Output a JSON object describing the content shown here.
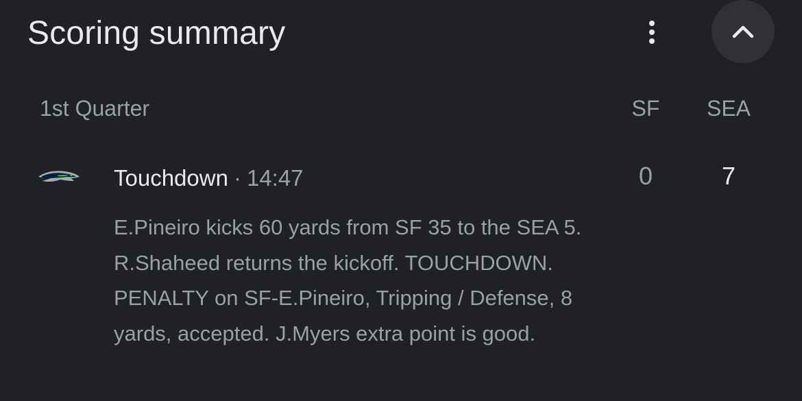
{
  "header": {
    "title": "Scoring summary",
    "more_icon": "more-vert-icon",
    "collapse_icon": "chevron-up-icon"
  },
  "table": {
    "quarter": "1st Quarter",
    "columns": [
      "SF",
      "SEA"
    ]
  },
  "plays": [
    {
      "team_logo": "seahawks-logo",
      "type": "Touchdown",
      "separator": "·",
      "time": "14:47",
      "score_sf": "0",
      "score_sea": "7",
      "description": "E.Pineiro kicks 60 yards from SF 35 to the SEA 5. R.Shaheed returns the kickoff. TOUCHDOWN. PENALTY on SF-E.Pineiro, Tripping / Defense, 8 yards, accepted. J.Myers extra point is good."
    }
  ],
  "colors": {
    "background": "#202124",
    "button_bg": "#303134",
    "primary_text": "#e8eaed",
    "secondary_text": "#9aa0a6",
    "seahawks_navy": "#002244",
    "seahawks_green": "#69be28",
    "seahawks_gray": "#a5acaf"
  }
}
